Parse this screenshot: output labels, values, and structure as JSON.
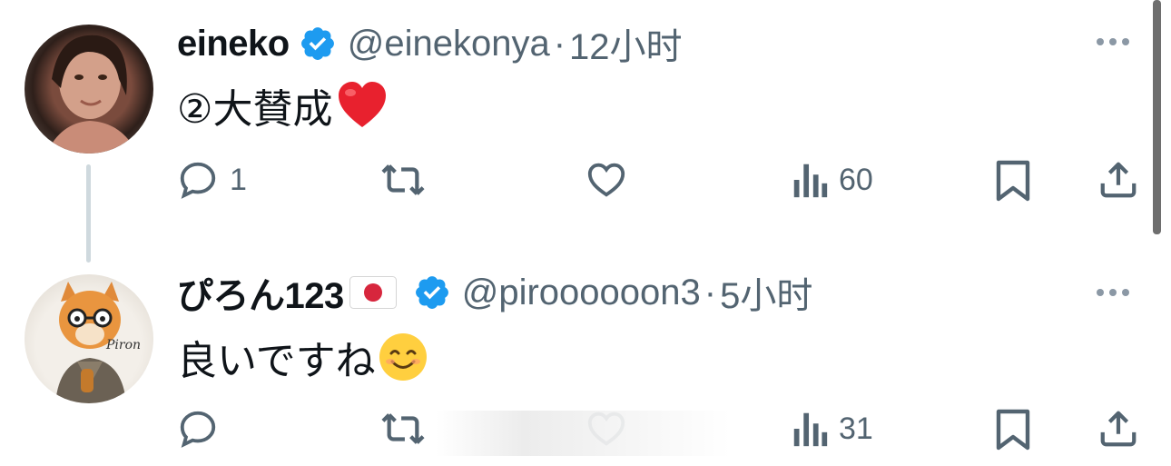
{
  "tweets": [
    {
      "name": "eineko",
      "handle": "@einekonya",
      "separator": "·",
      "time": "12小时",
      "text": "②大賛成",
      "emoji": "❤️",
      "counts": {
        "reply": "1",
        "retweet": "",
        "like": "",
        "views": "60"
      }
    },
    {
      "name": "ぴろん123",
      "flag": "🇯🇵",
      "handle": "@piroooooon3",
      "separator": "·",
      "time": "5小时",
      "text": "良いですね",
      "emoji": "😊",
      "avatar_text": "Piron",
      "counts": {
        "reply": "",
        "retweet": "",
        "like": "",
        "views": "31"
      }
    }
  ],
  "icons": {
    "verified": "verified-badge-icon",
    "more": "more-options-icon",
    "reply": "reply-icon",
    "retweet": "retweet-icon",
    "like": "like-icon",
    "views": "views-icon",
    "bookmark": "bookmark-icon",
    "share": "share-icon"
  },
  "colors": {
    "verified": "#1d9bf0",
    "secondary_text": "#536471",
    "thread_line": "#cfd9de"
  }
}
